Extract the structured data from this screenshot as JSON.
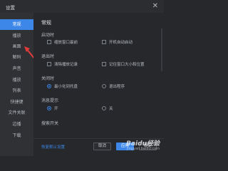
{
  "window": {
    "title": "设置",
    "close_glyph": "✕"
  },
  "sidebar": {
    "items": [
      {
        "label": "常规",
        "active": true
      },
      {
        "label": "播放"
      },
      {
        "label": "画面"
      },
      {
        "label": "解码"
      },
      {
        "label": "声音"
      },
      {
        "label": "播放"
      },
      {
        "label": "列表"
      },
      {
        "label": "快捷键"
      },
      {
        "label": "文件关联"
      },
      {
        "label": "边播"
      },
      {
        "label": "下载"
      }
    ]
  },
  "content": {
    "section_title": "常规",
    "startup": {
      "label": "启动时",
      "option1": "缩放窗口最前",
      "option2": "开机自动启动"
    },
    "exit": {
      "label": "退出时",
      "option1": "清除播放记录",
      "option2": "记住窗口大小和位置"
    },
    "close": {
      "label": "关闭时",
      "option1": "最小化到托盘",
      "option2": "退出程序"
    },
    "notice": {
      "label": "消息提示",
      "option1": "开",
      "option2": "关"
    },
    "search": {
      "label": "搜索开关"
    }
  },
  "footer": {
    "reset_label": "恢复默认设置",
    "cancel_label": "取消",
    "apply_label": "应用",
    "ok_label": "确定"
  },
  "watermark": {
    "brand": "Baidu经验",
    "url": "jingyan.baidu.com"
  },
  "colors": {
    "accent": "#3d87e8",
    "background": "#26282c",
    "sidebar": "#2f3135"
  }
}
